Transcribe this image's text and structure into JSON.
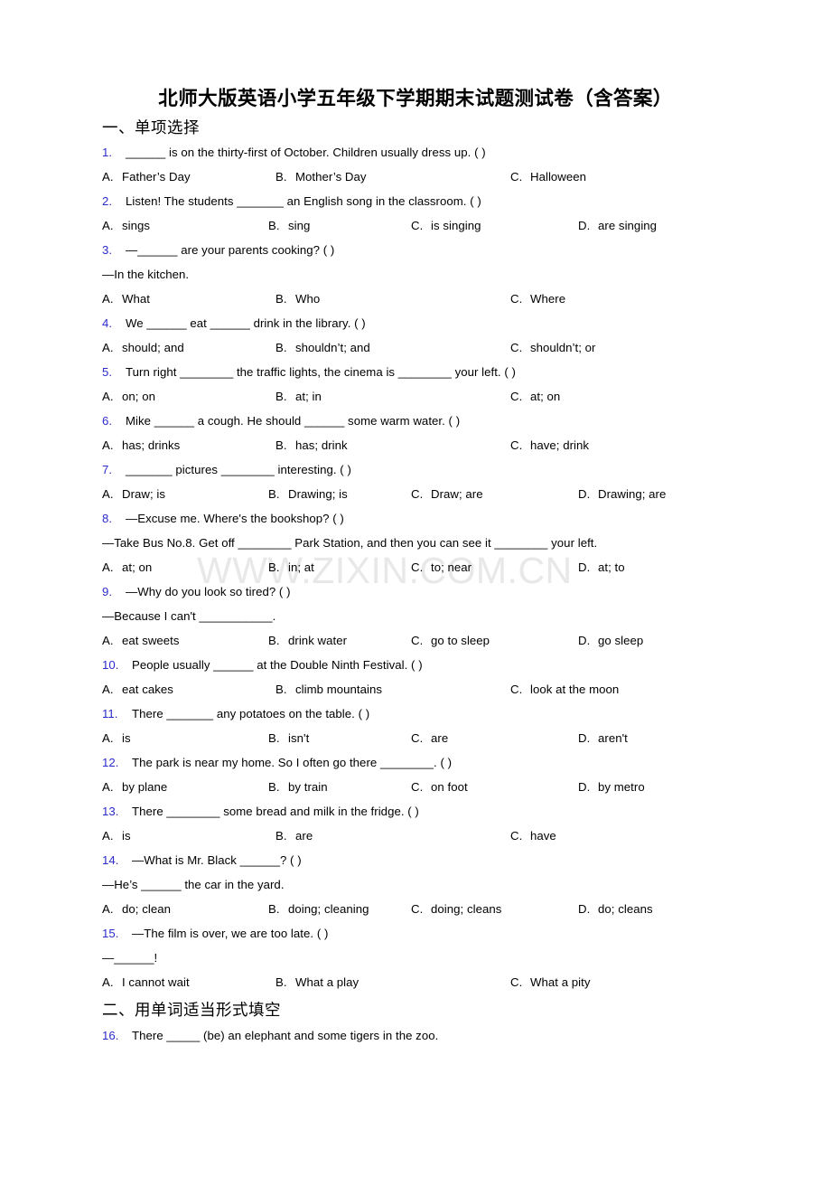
{
  "document": {
    "title": "北师大版英语小学五年级下学期期末试题测试卷（含答案）",
    "watermark": "WWW.ZIXIN.COM.CN",
    "accent_color": "#2b2bcc",
    "background_color": "#ffffff",
    "text_color": "#000000"
  },
  "sections": [
    {
      "heading": "一、单项选择"
    },
    {
      "heading": "二、用单词适当形式填空"
    }
  ],
  "questions": [
    {
      "num": "1.",
      "stem": "______ is on the thirty-first of October. Children usually dress up. (   )",
      "cont": null,
      "columns": 3,
      "options": [
        {
          "letter": "A.",
          "text": "Father’s Day"
        },
        {
          "letter": "B.",
          "text": "Mother’s Day"
        },
        {
          "letter": "C.",
          "text": "Halloween"
        }
      ]
    },
    {
      "num": "2.",
      "stem": "Listen! The students _______ an English song in the classroom. (  )",
      "cont": null,
      "columns": 4,
      "options": [
        {
          "letter": "A.",
          "text": "sings"
        },
        {
          "letter": "B.",
          "text": "sing"
        },
        {
          "letter": "C.",
          "text": "is singing"
        },
        {
          "letter": "D.",
          "text": "are singing"
        }
      ]
    },
    {
      "num": "3.",
      "stem": "—______ are your parents cooking? (  )",
      "cont": "—In the kitchen.",
      "columns": 3,
      "options": [
        {
          "letter": "A.",
          "text": "What"
        },
        {
          "letter": "B.",
          "text": "Who"
        },
        {
          "letter": "C.",
          "text": "Where"
        }
      ]
    },
    {
      "num": "4.",
      "stem": "We ______ eat ______ drink in the library. (  )",
      "cont": null,
      "columns": 3,
      "options": [
        {
          "letter": "A.",
          "text": "should; and"
        },
        {
          "letter": "B.",
          "text": "shouldn’t; and"
        },
        {
          "letter": "C.",
          "text": "shouldn’t; or"
        }
      ]
    },
    {
      "num": "5.",
      "stem": "Turn right ________ the traffic lights, the cinema is ________ your left. (  )",
      "cont": null,
      "columns": 3,
      "options": [
        {
          "letter": "A.",
          "text": "on; on"
        },
        {
          "letter": "B.",
          "text": "at; in"
        },
        {
          "letter": "C.",
          "text": "at; on"
        }
      ]
    },
    {
      "num": "6.",
      "stem": "Mike ______ a cough. He should ______ some warm water. (  )",
      "cont": null,
      "columns": 3,
      "options": [
        {
          "letter": "A.",
          "text": "has; drinks"
        },
        {
          "letter": "B.",
          "text": "has; drink"
        },
        {
          "letter": "C.",
          "text": "have; drink"
        }
      ]
    },
    {
      "num": "7.",
      "stem": "_______ pictures ________ interesting. (  )",
      "cont": null,
      "columns": 4,
      "options": [
        {
          "letter": "A.",
          "text": "Draw; is"
        },
        {
          "letter": "B.",
          "text": "Drawing; is"
        },
        {
          "letter": "C.",
          "text": "Draw; are"
        },
        {
          "letter": "D.",
          "text": "Drawing; are"
        }
      ]
    },
    {
      "num": "8.",
      "stem": "—Excuse me. Where's the bookshop? (  )",
      "cont": "—Take Bus No.8. Get off ________ Park Station, and then you can see it ________ your left.",
      "columns": 4,
      "options": [
        {
          "letter": "A.",
          "text": "at; on"
        },
        {
          "letter": "B.",
          "text": "in; at"
        },
        {
          "letter": "C.",
          "text": "to; near"
        },
        {
          "letter": "D.",
          "text": "at; to"
        }
      ]
    },
    {
      "num": "9.",
      "stem": "—Why do you look so tired? (  )",
      "cont": "—Because I can't ___________.",
      "columns": 4,
      "options": [
        {
          "letter": "A.",
          "text": "eat sweets"
        },
        {
          "letter": "B.",
          "text": "drink water"
        },
        {
          "letter": "C.",
          "text": "go to sleep"
        },
        {
          "letter": "D.",
          "text": "go sleep"
        }
      ]
    },
    {
      "num": "10.",
      "stem": "People usually ______ at the Double Ninth Festival. (   )",
      "cont": null,
      "columns": 3,
      "options": [
        {
          "letter": "A.",
          "text": "eat cakes"
        },
        {
          "letter": "B.",
          "text": "climb mountains"
        },
        {
          "letter": "C.",
          "text": "look at the moon"
        }
      ]
    },
    {
      "num": "11.",
      "stem": "There _______ any potatoes on the table. (  )",
      "cont": null,
      "columns": 4,
      "options": [
        {
          "letter": "A.",
          "text": "is"
        },
        {
          "letter": "B.",
          "text": "isn't"
        },
        {
          "letter": "C.",
          "text": "are"
        },
        {
          "letter": "D.",
          "text": "aren't"
        }
      ]
    },
    {
      "num": "12.",
      "stem": "The park is near my home. So I often go there ________. (  )",
      "cont": null,
      "columns": 4,
      "options": [
        {
          "letter": "A.",
          "text": "by plane"
        },
        {
          "letter": "B.",
          "text": "by train"
        },
        {
          "letter": "C.",
          "text": "on foot"
        },
        {
          "letter": "D.",
          "text": "by metro"
        }
      ]
    },
    {
      "num": "13.",
      "stem": "There ________ some bread and milk in the fridge. (  )",
      "cont": null,
      "columns": 3,
      "options": [
        {
          "letter": "A.",
          "text": "is"
        },
        {
          "letter": "B.",
          "text": "are"
        },
        {
          "letter": "C.",
          "text": "have"
        }
      ]
    },
    {
      "num": "14.",
      "stem": "—What is Mr. Black ______? (   )",
      "cont": "—He’s ______ the car in the yard.",
      "columns": 4,
      "options": [
        {
          "letter": "A.",
          "text": "do; clean"
        },
        {
          "letter": "B.",
          "text": "doing; cleaning"
        },
        {
          "letter": "C.",
          "text": "doing; cleans"
        },
        {
          "letter": "D.",
          "text": "do; cleans"
        }
      ]
    },
    {
      "num": "15.",
      "stem": "—The film is over, we are too late. (   )",
      "cont": "—______!",
      "columns": 3,
      "options": [
        {
          "letter": "A.",
          "text": "I cannot wait"
        },
        {
          "letter": "B.",
          "text": "What a play"
        },
        {
          "letter": "C.",
          "text": "What a pity"
        }
      ]
    }
  ],
  "fill_in_questions": [
    {
      "num": "16.",
      "stem": "There _____ (be) an elephant and some tigers in the zoo."
    }
  ]
}
